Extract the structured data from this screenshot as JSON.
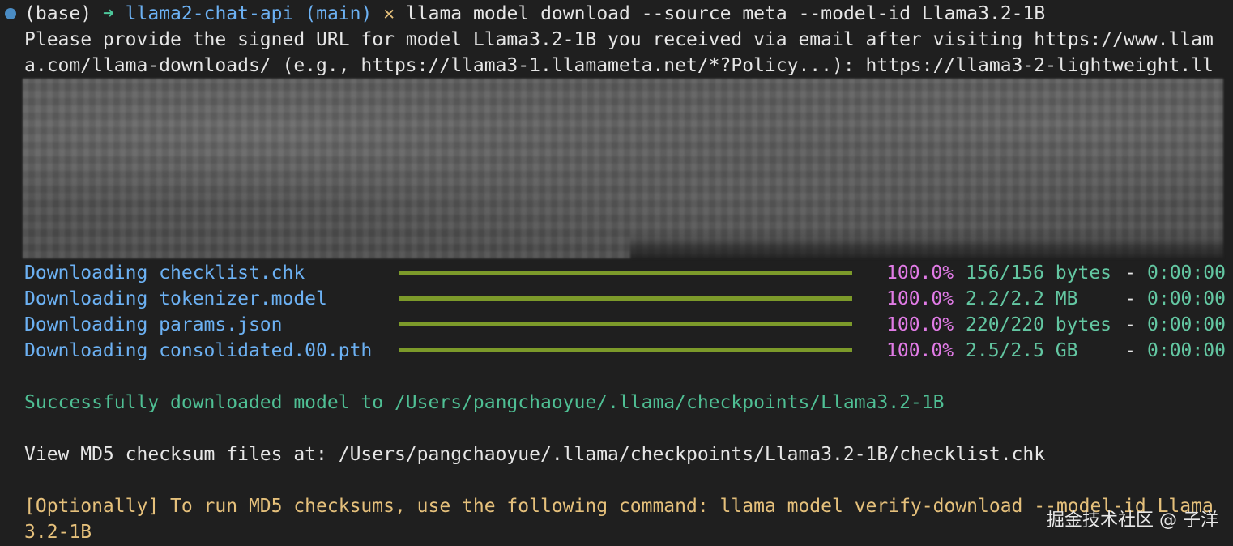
{
  "prompt": {
    "env": "(base)",
    "arrow": "➜",
    "repo": "llama2-chat-api",
    "branch": "(main)",
    "dirty": "✕",
    "command": "llama model download --source meta --model-id Llama3.2-1B"
  },
  "request": {
    "line1": "Please provide the signed URL for model Llama3.2-1B you received via email after visiting https://www.llam",
    "line2": "a.com/llama-downloads/ (e.g., https://llama3-1.llamameta.net/*?Policy...): https://llama3-2-lightweight.ll"
  },
  "downloads": [
    {
      "label": "Downloading checklist.chk",
      "progress": 1.0,
      "percent": "100.0%",
      "size": "156/156 bytes",
      "dash": "-",
      "time": "0:00:00"
    },
    {
      "label": "Downloading tokenizer.model",
      "progress": 1.0,
      "percent": "100.0%",
      "size": "2.2/2.2 MB",
      "dash": "-",
      "time": "0:00:00"
    },
    {
      "label": "Downloading params.json",
      "progress": 1.0,
      "percent": "100.0%",
      "size": "220/220 bytes",
      "dash": "-",
      "time": "0:00:00"
    },
    {
      "label": "Downloading consolidated.00.pth",
      "progress": 1.0,
      "percent": "100.0%",
      "size": "2.5/2.5 GB",
      "dash": "-",
      "time": "0:00:00"
    }
  ],
  "success": "Successfully downloaded model to /Users/pangchaoyue/.llama/checkpoints/Llama3.2-1B",
  "checksum_info": "View MD5 checksum files at: /Users/pangchaoyue/.llama/checkpoints/Llama3.2-1B/checklist.chk",
  "optional": {
    "line1": "[Optionally] To run MD5 checksums, use the following command: llama model verify-download --model-id Llama",
    "line2": "3.2-1B"
  },
  "watermark": "掘金技术社区 @ 子洋",
  "colors": {
    "background": "#1f1f1f",
    "prompt_dot": "#4a8cc4",
    "download_label": "#6cb1f3",
    "progress_bar": "#7c9a2a",
    "percent": "#e17be6",
    "size": "#63c7a2",
    "success": "#4fbf94",
    "optional": "#e5c07b"
  }
}
